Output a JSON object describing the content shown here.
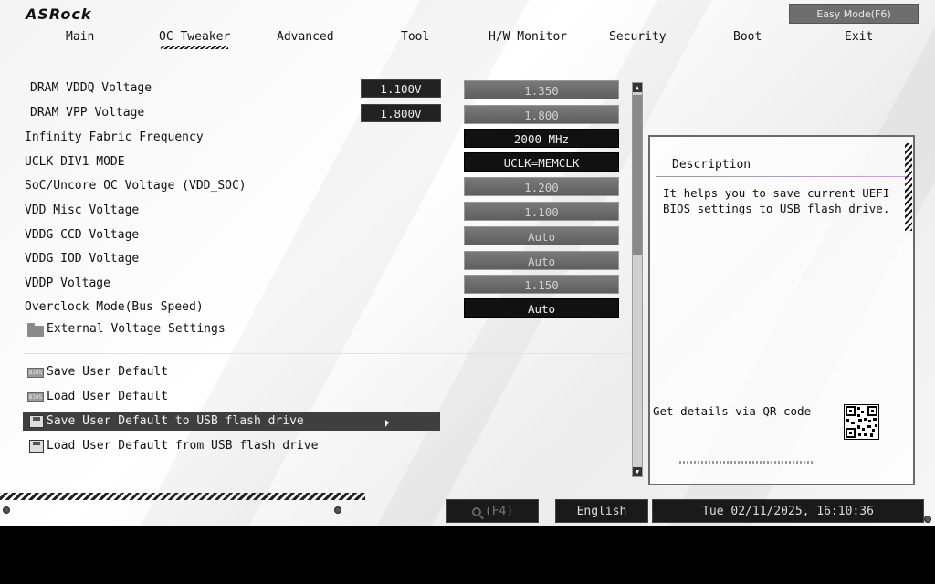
{
  "brand": "ASRock",
  "easy_mode_button": "Easy Mode(F6)",
  "tabs": [
    {
      "label": "Main"
    },
    {
      "label": "OC Tweaker",
      "active": true
    },
    {
      "label": "Advanced"
    },
    {
      "label": "Tool"
    },
    {
      "label": "H/W Monitor"
    },
    {
      "label": "Security"
    },
    {
      "label": "Boot"
    },
    {
      "label": "Exit"
    }
  ],
  "settings": [
    {
      "label": "DRAM VDDQ Voltage",
      "current": "1.100V",
      "value": "1.350"
    },
    {
      "label": "DRAM VPP Voltage",
      "current": "1.800V",
      "value": "1.800"
    },
    {
      "label": "Infinity Fabric Frequency",
      "value": "2000 MHz"
    },
    {
      "label": "UCLK DIV1 MODE",
      "value": "UCLK=MEMCLK"
    },
    {
      "label": "SoC/Uncore OC Voltage (VDD_SOC)",
      "value": "1.200"
    },
    {
      "label": "VDD Misc Voltage",
      "value": "1.100"
    },
    {
      "label": "VDDG CCD Voltage",
      "value": "Auto"
    },
    {
      "label": "VDDG IOD Voltage",
      "value": "Auto"
    },
    {
      "label": "VDDP Voltage",
      "value": "1.150"
    },
    {
      "label": "Overclock Mode(Bus Speed)",
      "value": "Auto"
    }
  ],
  "submenu": {
    "label": "External Voltage Settings",
    "icon": "folder-icon"
  },
  "actions": [
    {
      "label": "Save User Default",
      "icon": "bios-icon"
    },
    {
      "label": "Load User Default",
      "icon": "bios-icon"
    },
    {
      "label": "Save User Default to USB flash drive",
      "icon": "floppy-icon",
      "selected": true
    },
    {
      "label": "Load User Default from USB flash drive",
      "icon": "floppy-icon"
    }
  ],
  "description": {
    "title": "Description",
    "text": "It helps you to save current UEFI BIOS settings to USB flash drive.",
    "qr_label": "Get details via QR code"
  },
  "footer": {
    "search": "(F4)",
    "language": "English",
    "datetime": "Tue 02/11/2025, 16:10:36"
  },
  "colors": {
    "selected_row": "#3f3f3f",
    "value_dark": "#111111",
    "value_dim": "#6a6a6a"
  }
}
